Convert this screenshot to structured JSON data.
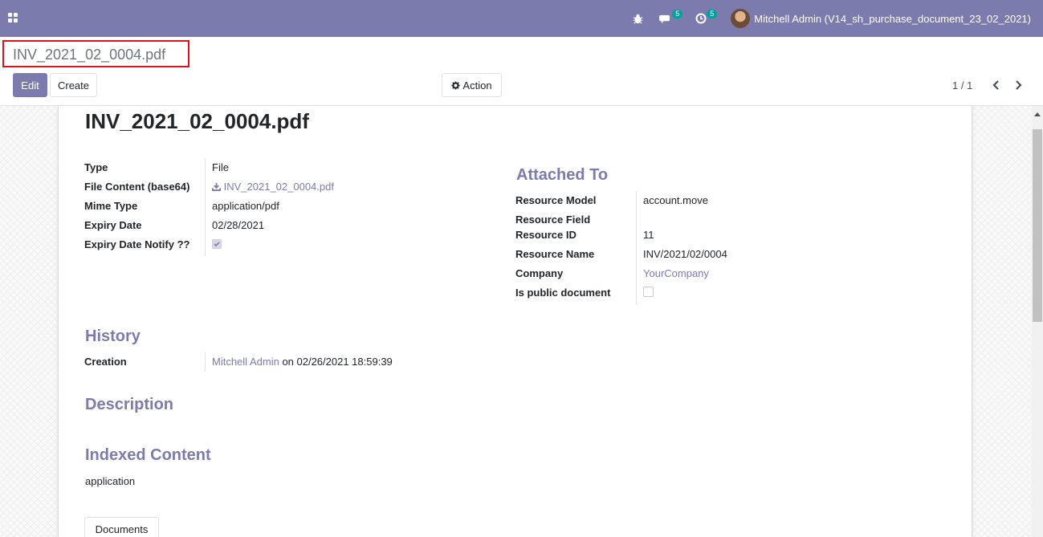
{
  "navbar": {
    "badges": {
      "messages": "5",
      "activities": "5"
    },
    "user": "Mitchell Admin (V14_sh_purchase_document_23_02_2021)"
  },
  "control_panel": {
    "breadcrumb": "INV_2021_02_0004.pdf",
    "edit_label": "Edit",
    "create_label": "Create",
    "action_label": "Action",
    "pager": "1 / 1"
  },
  "record": {
    "title": "INV_2021_02_0004.pdf",
    "left_fields": {
      "type": {
        "label": "Type",
        "value": "File"
      },
      "file_content": {
        "label": "File Content (base64)",
        "value": "INV_2021_02_0004.pdf"
      },
      "mime_type": {
        "label": "Mime Type",
        "value": "application/pdf"
      },
      "expiry_date": {
        "label": "Expiry Date",
        "value": "02/28/2021"
      },
      "expiry_notify": {
        "label": "Expiry Date Notify ??",
        "checked": true
      }
    },
    "attached_to": {
      "title": "Attached To",
      "resource_model": {
        "label": "Resource Model",
        "value": "account.move"
      },
      "resource_field": {
        "label": "Resource Field",
        "value": ""
      },
      "resource_id": {
        "label": "Resource ID",
        "value": "11"
      },
      "resource_name": {
        "label": "Resource Name",
        "value": "INV/2021/02/0004"
      },
      "company": {
        "label": "Company",
        "value": "YourCompany"
      },
      "is_public": {
        "label": "Is public document",
        "checked": false
      }
    },
    "history": {
      "title": "History",
      "creation_label": "Creation",
      "creator": "Mitchell Admin",
      "creation_date": "on 02/26/2021 18:59:39"
    },
    "description": {
      "title": "Description"
    },
    "indexed_content": {
      "title": "Indexed Content",
      "value": "application"
    },
    "tabs": {
      "documents": "Documents"
    }
  },
  "colors": {
    "brand": "#7c7bad",
    "badge": "#00a09d",
    "highlight_border": "#d7141a"
  }
}
